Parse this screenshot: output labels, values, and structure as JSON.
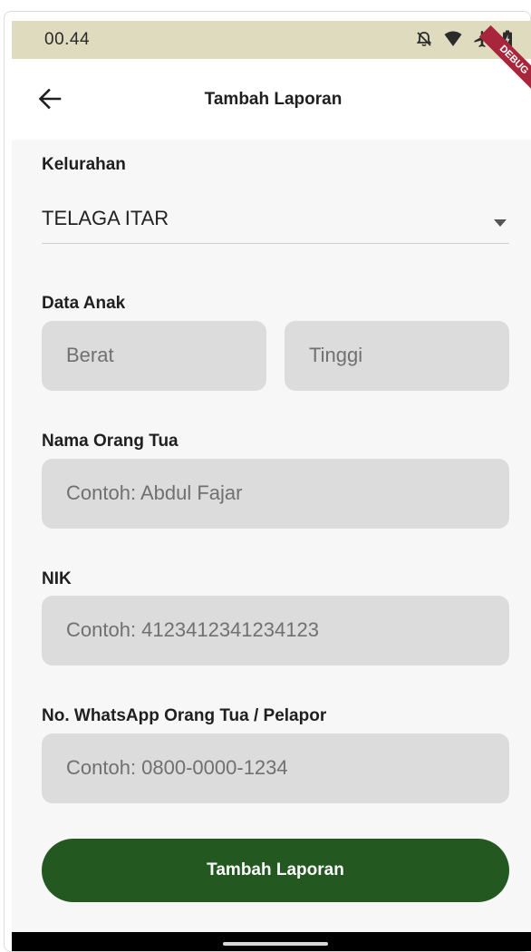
{
  "status_bar": {
    "time": "00.44",
    "icons": [
      "alarm-off-icon",
      "wifi-icon",
      "airplane-icon",
      "battery-icon"
    ],
    "background": "#dedbbe"
  },
  "app_bar": {
    "back_icon": "arrow-left-icon",
    "title": "Tambah Laporan",
    "debug_banner": "DEBUG"
  },
  "form": {
    "kelurahan": {
      "label": "Kelurahan",
      "value": "TELAGA ITAR"
    },
    "data_anak": {
      "label": "Data Anak",
      "berat_placeholder": "Berat",
      "tinggi_placeholder": "Tinggi"
    },
    "nama_orang_tua": {
      "label": "Nama Orang Tua",
      "placeholder": "Contoh: Abdul Fajar"
    },
    "nik": {
      "label": "NIK",
      "placeholder": "Contoh: 4123412341234123"
    },
    "whatsapp": {
      "label": "No. WhatsApp Orang Tua / Pelapor",
      "placeholder": "Contoh: 0800-0000-1234"
    },
    "submit_label": "Tambah Laporan"
  },
  "colors": {
    "primary": "#235821",
    "field_background": "#dcdcdc",
    "content_background": "#f7f7f7"
  }
}
